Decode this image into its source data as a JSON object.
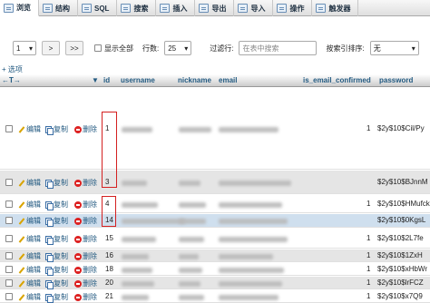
{
  "tabs": [
    {
      "label": "浏览",
      "icon": "browse-icon",
      "active": true
    },
    {
      "label": "结构",
      "icon": "structure-icon"
    },
    {
      "label": "SQL",
      "icon": "sql-icon"
    },
    {
      "label": "搜索",
      "icon": "search-icon"
    },
    {
      "label": "插入",
      "icon": "insert-icon"
    },
    {
      "label": "导出",
      "icon": "export-icon"
    },
    {
      "label": "导入",
      "icon": "import-icon"
    },
    {
      "label": "操作",
      "icon": "operations-icon"
    },
    {
      "label": "触发器",
      "icon": "triggers-icon"
    }
  ],
  "pager": {
    "page_value": "1",
    "next_label": ">",
    "last_label": ">>",
    "show_all_label": "显示全部",
    "rows_label": "行数:",
    "rows_value": "25",
    "filter_label": "过滤行:",
    "filter_placeholder": "在表中搜索",
    "sort_label": "按索引排序:",
    "sort_value": "无"
  },
  "options_label": "+ 选项",
  "headers": {
    "arrows": "←T→",
    "id": "id",
    "username": "username",
    "nickname": "nickname",
    "email": "email",
    "is_email_confirmed": "is_email_confirmed",
    "password": "password"
  },
  "actions": {
    "edit": "编辑",
    "copy": "复制",
    "delete": "删除"
  },
  "rows": [
    {
      "id": "1",
      "confirmed": "1",
      "password": "$2y$10$Cil/Py"
    },
    {
      "id": "3",
      "confirmed": "",
      "password": "$2y$10$BJnnM"
    },
    {
      "id": "4",
      "confirmed": "1",
      "password": "$2y$10$HMufck"
    },
    {
      "id": "14",
      "confirmed": "",
      "password": "$2y$10$0KgsL"
    },
    {
      "id": "15",
      "confirmed": "1",
      "password": "$2y$10$2L7fe"
    },
    {
      "id": "16",
      "confirmed": "1",
      "password": "$2y$10$1ZxH"
    },
    {
      "id": "18",
      "confirmed": "1",
      "password": "$2y$10$xHbWr"
    },
    {
      "id": "20",
      "confirmed": "1",
      "password": "$2y$10$lrFCZ"
    },
    {
      "id": "21",
      "confirmed": "1",
      "password": "$2y$10$x7Q9"
    }
  ],
  "colors": {
    "highlight_box": "#d42020",
    "link": "#235a81",
    "row_highlight": "#cfdfee"
  }
}
